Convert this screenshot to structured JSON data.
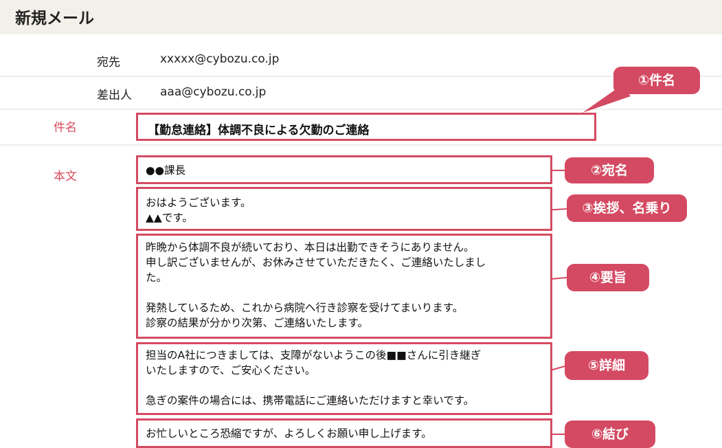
{
  "window": {
    "title": "新規メール"
  },
  "fields": {
    "to": {
      "label": "宛先",
      "value": "xxxxx@cybozu.co.jp"
    },
    "from": {
      "label": "差出人",
      "value": "aaa@cybozu.co.jp"
    },
    "subject": {
      "label": "件名",
      "value": "【勤怠連絡】体調不良による欠勤のご連絡"
    },
    "body": {
      "label": "本文"
    }
  },
  "body_sections": [
    {
      "text": "●●課長",
      "tag": "②宛名"
    },
    {
      "text": "おはようございます。\n▲▲です。",
      "tag": "③挨拶、名乗り"
    },
    {
      "text": "昨晩から体調不良が続いており、本日は出勤できそうにありません。\n申し訳ございませんが、お休みさせていただきたく、ご連絡いたしまし\nた。\n\n発熱しているため、これから病院へ行き診察を受けてまいります。\n診察の結果が分かり次第、ご連絡いたします。",
      "tag": "④要旨"
    },
    {
      "text": "担当のA社につきましては、支障がないようこの後■■さんに引き継ぎ\nいたしますので、ご安心ください。\n\n急ぎの案件の場合には、携帯電話にご連絡いただけますと幸いです。",
      "tag": "⑤詳細"
    },
    {
      "text": "お忙しいところ恐縮ですが、よろしくお願い申し上げます。",
      "tag": "⑥結び"
    }
  ],
  "subject_tag": "①件名",
  "colors": {
    "accent": "#d44a62",
    "header_bg": "#f3f0e9",
    "label_red": "#d84a5c"
  }
}
